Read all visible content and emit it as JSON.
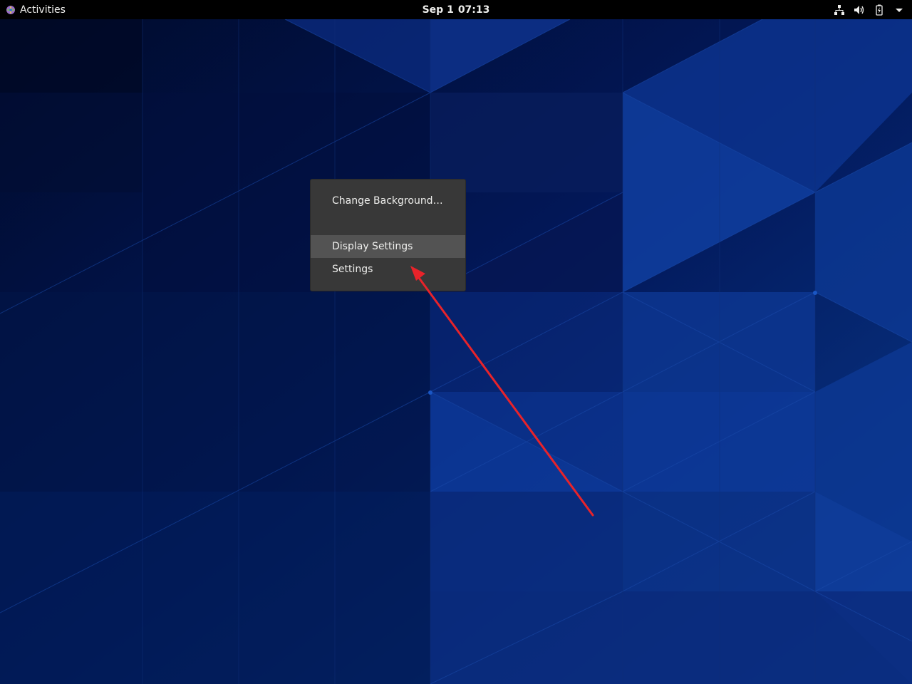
{
  "topbar": {
    "activities_label": "Activities",
    "clock_date": "Sep 1",
    "clock_time": "07:13",
    "status_icons": [
      "network-wired-icon",
      "volume-icon",
      "battery-icon",
      "system-menu-arrow-icon"
    ]
  },
  "context_menu": {
    "items": [
      {
        "label": "Change Background…"
      },
      {
        "label": "Display Settings",
        "highlighted": true
      },
      {
        "label": "Settings"
      }
    ]
  },
  "colors": {
    "topbar_bg": "#000000",
    "menu_bg": "#383838",
    "menu_highlight": "#535353",
    "wallpaper_base": "#031a4a",
    "annotation_arrow": "#e8232a"
  }
}
